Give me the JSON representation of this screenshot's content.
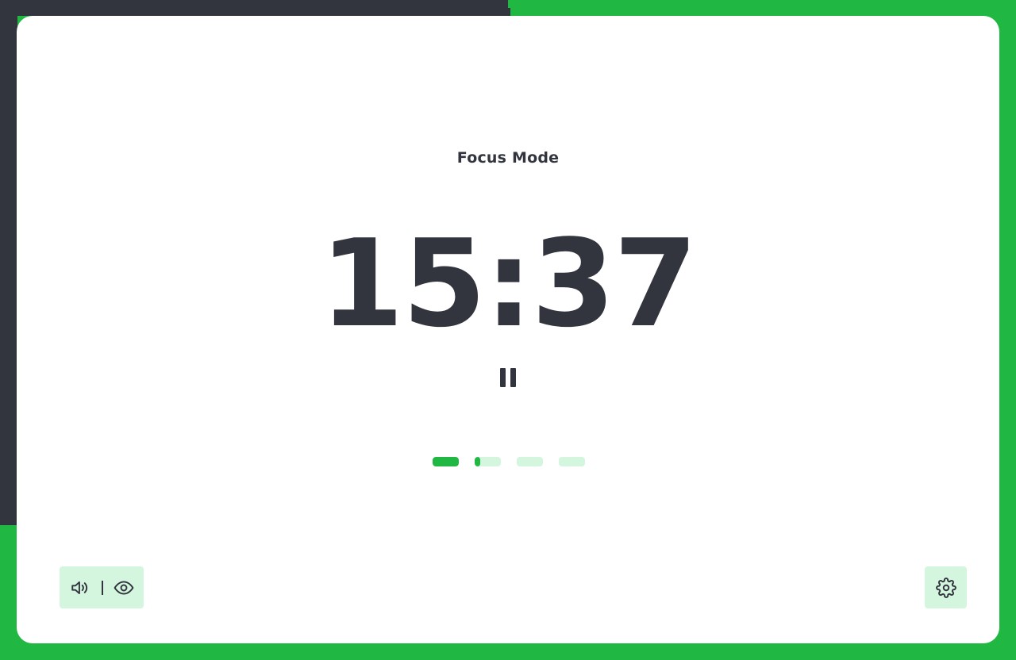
{
  "mode": {
    "title": "Focus Mode"
  },
  "timer": {
    "display": "15:37",
    "state": "running"
  },
  "sessions": {
    "total": 4,
    "progress": [
      1.0,
      0.2,
      0.0,
      0.0
    ]
  },
  "controls": {
    "pause_icon": "pause-icon",
    "sound_icon": "speaker-icon",
    "visibility_icon": "eye-icon",
    "settings_icon": "gear-icon"
  },
  "colors": {
    "accent": "#20b843",
    "accent_light": "#d4f6df",
    "dark": "#32353e",
    "card": "#ffffff"
  }
}
